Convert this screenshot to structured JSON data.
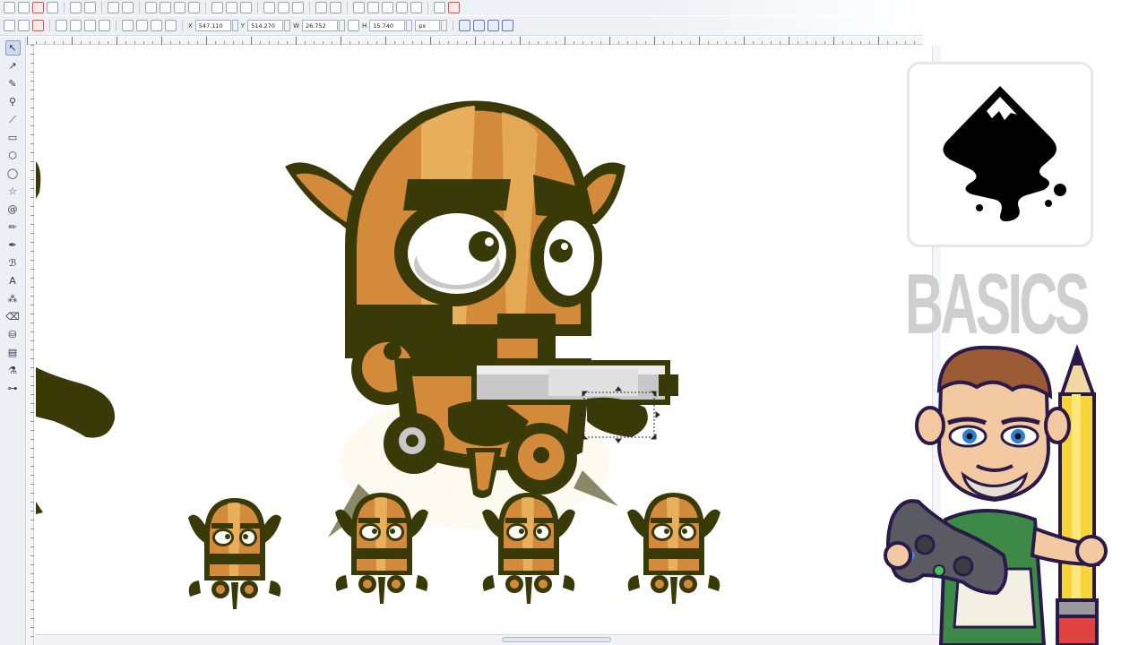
{
  "app": {
    "name": "Inkscape"
  },
  "commands_bar": {
    "groups": [
      [
        "new-icon",
        "open-icon",
        "save-icon",
        "print-icon"
      ],
      [
        "import-icon",
        "export-icon"
      ],
      [
        "undo-icon",
        "redo-icon"
      ],
      [
        "copy-icon",
        "paste-icon",
        "cut-icon",
        "delete-icon"
      ],
      [
        "zoom-selection-icon",
        "zoom-drawing-icon",
        "zoom-page-icon"
      ],
      [
        "duplicate-icon",
        "clone-icon",
        "unlink-clone-icon"
      ],
      [
        "group-icon",
        "ungroup-icon"
      ],
      [
        "fill-stroke-icon",
        "text-font-icon",
        "xml-editor-icon",
        "align-icon",
        "document-props-icon"
      ],
      [
        "preferences-icon",
        "close-doc-icon"
      ]
    ]
  },
  "tool_controls": {
    "x_label": "X",
    "x_value": "547.110",
    "y_label": "Y",
    "y_value": "514.270",
    "w_label": "W",
    "w_value": "26.752",
    "h_label": "H",
    "h_value": "15.740",
    "units": "px"
  },
  "toolbox": {
    "tools": [
      {
        "name": "selector-tool",
        "glyph": "↖",
        "active": true
      },
      {
        "name": "node-tool",
        "glyph": "↗"
      },
      {
        "name": "tweak-tool",
        "glyph": "✎"
      },
      {
        "name": "zoom-tool",
        "glyph": "⚲"
      },
      {
        "name": "measure-tool",
        "glyph": "⟋"
      },
      {
        "name": "rectangle-tool",
        "glyph": "▭"
      },
      {
        "name": "3d-box-tool",
        "glyph": "⬡"
      },
      {
        "name": "ellipse-tool",
        "glyph": "◯"
      },
      {
        "name": "star-tool",
        "glyph": "☆"
      },
      {
        "name": "spiral-tool",
        "glyph": "@"
      },
      {
        "name": "pencil-tool",
        "glyph": "✏"
      },
      {
        "name": "pen-tool",
        "glyph": "✒"
      },
      {
        "name": "calligraphy-tool",
        "glyph": "ℬ"
      },
      {
        "name": "text-tool",
        "glyph": "A"
      },
      {
        "name": "spray-tool",
        "glyph": "⁂"
      },
      {
        "name": "eraser-tool",
        "glyph": "⌫"
      },
      {
        "name": "paint-bucket-tool",
        "glyph": "⛁"
      },
      {
        "name": "gradient-tool",
        "glyph": "▤"
      },
      {
        "name": "dropper-tool",
        "glyph": "⚗"
      },
      {
        "name": "connector-tool",
        "glyph": "⊶"
      }
    ]
  },
  "overlay": {
    "title": "BASICS",
    "logo": "inkscape-logo-icon"
  },
  "colors": {
    "robot_orange": "#d38a3a",
    "robot_light": "#e8b05c",
    "robot_outline": "#3a3a08",
    "gun_gray": "#c8c8c8",
    "basics_gray": "#cfcfcf",
    "pencil_yellow": "#f6d43a"
  }
}
